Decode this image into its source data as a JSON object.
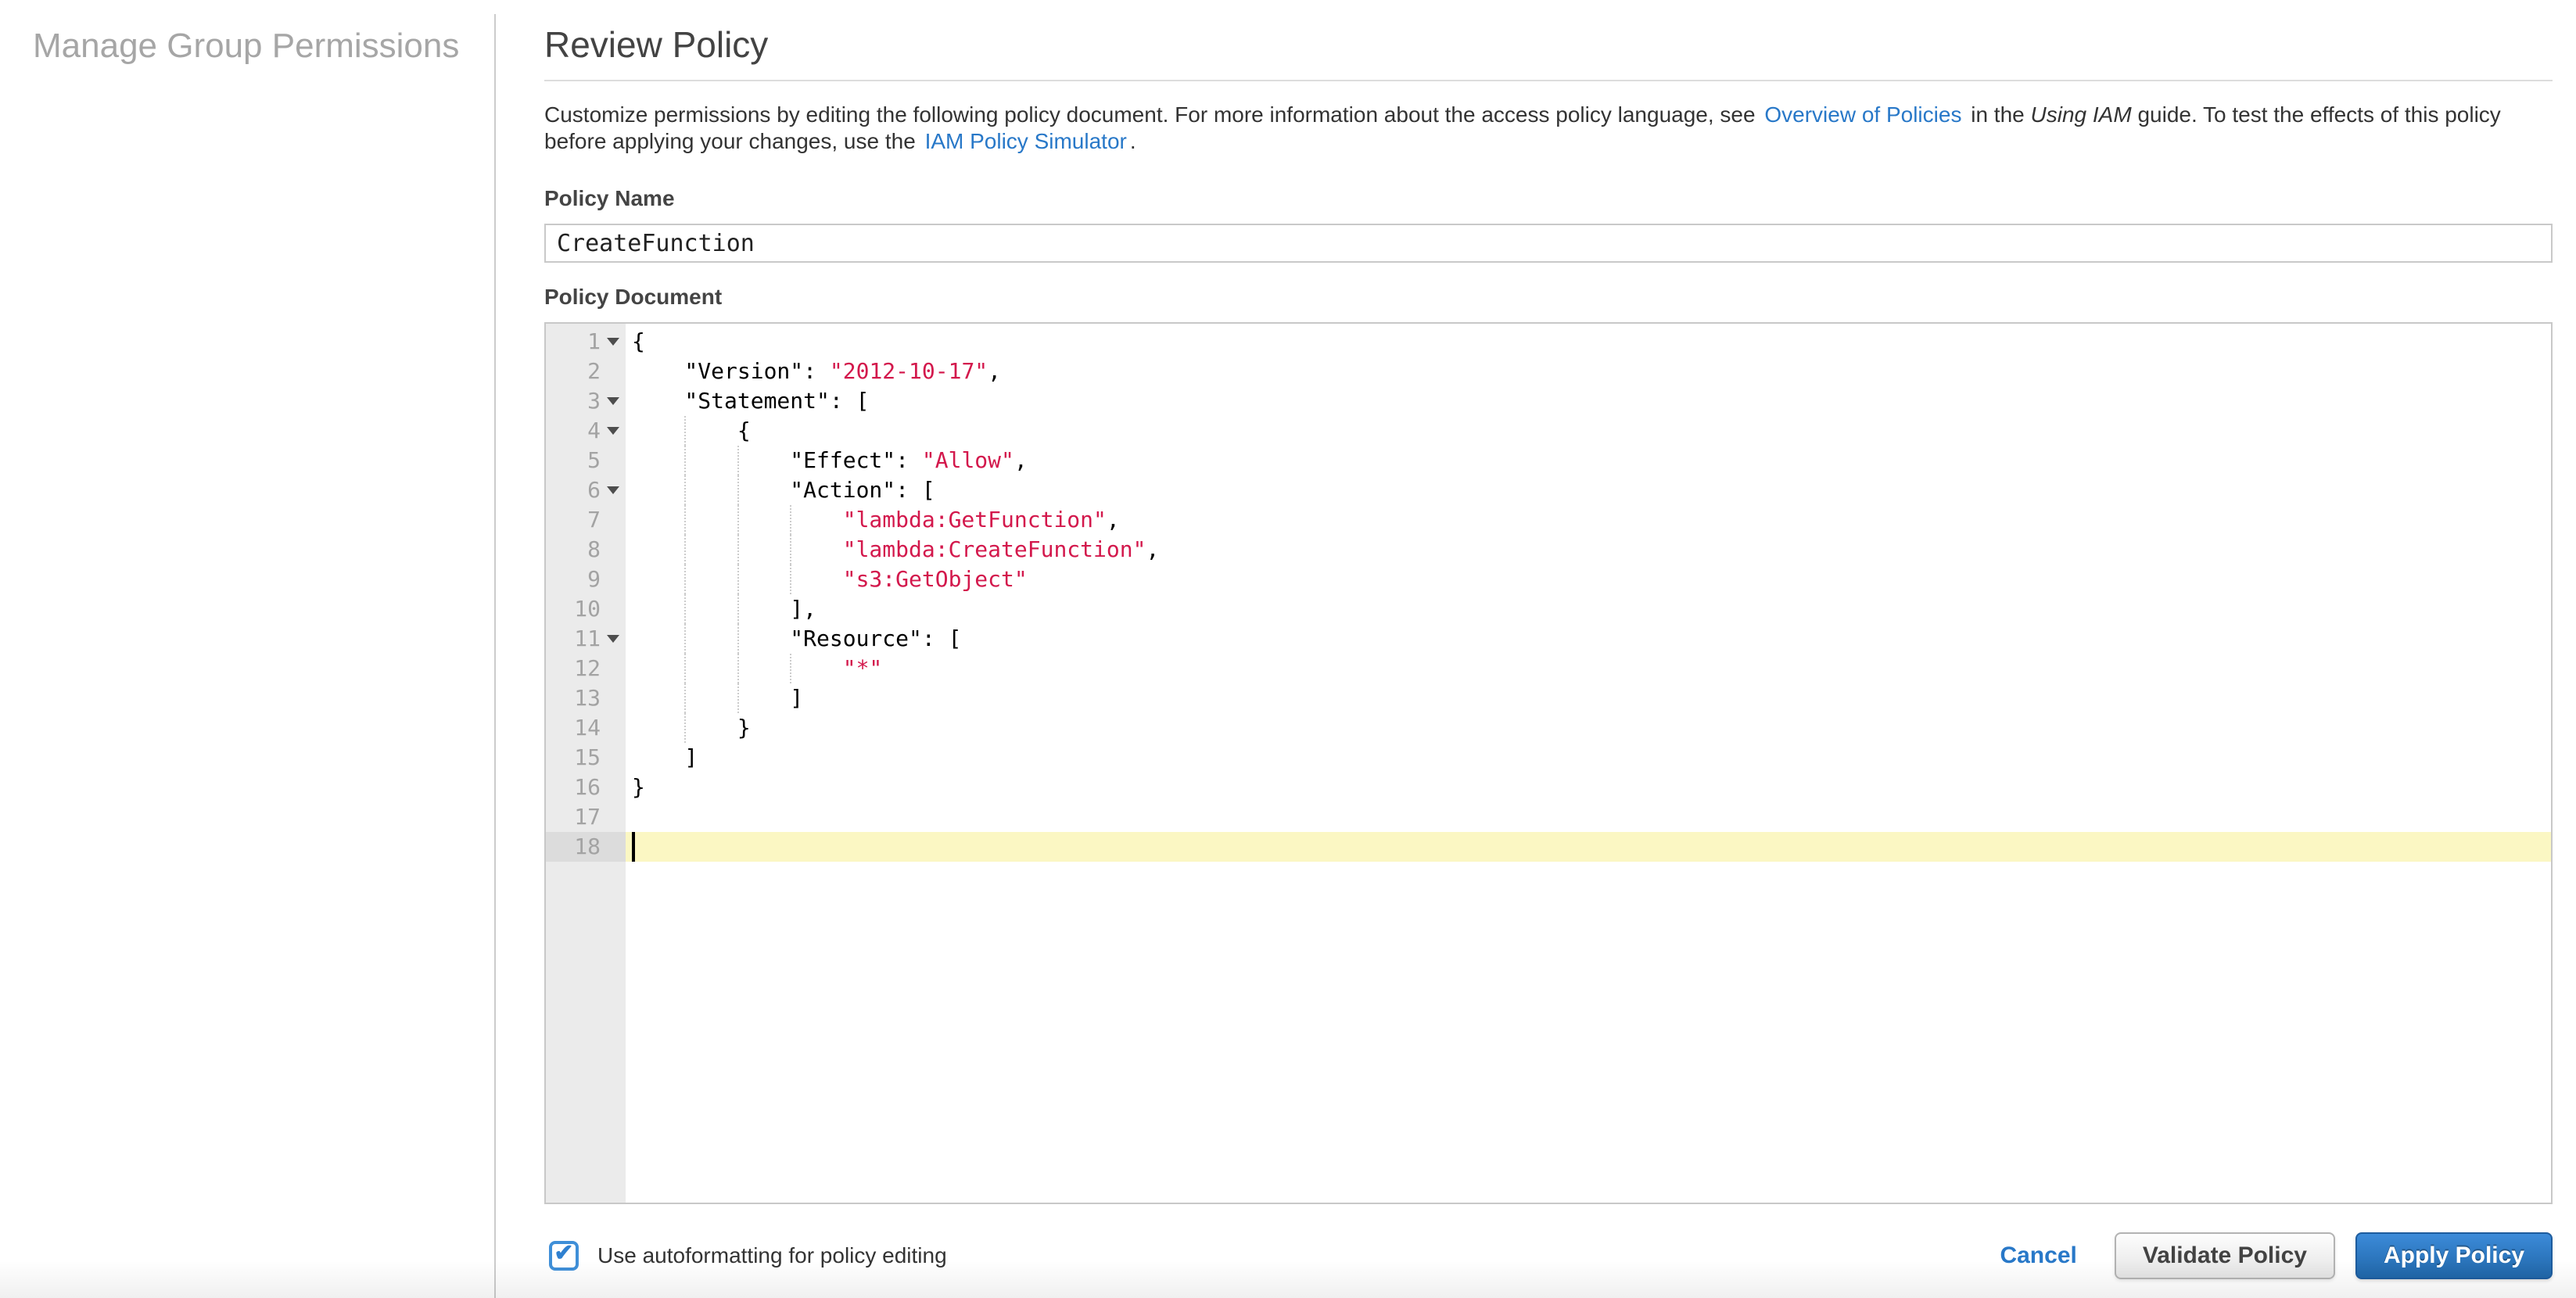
{
  "sidebar": {
    "title": "Manage Group Permissions"
  },
  "header": {
    "title": "Review Policy"
  },
  "description": {
    "parts": [
      {
        "t": "Customize permissions by editing the following policy document. For more information about the access policy language, see"
      },
      {
        "t": "Overview of Policies",
        "link": true
      },
      {
        "t": "in the"
      },
      {
        "t": "Using IAM",
        "italic": true
      },
      {
        "t": "guide. To test the effects of this policy"
      },
      {
        "br": true
      },
      {
        "t": "before applying your changes, use the"
      },
      {
        "t": "IAM Policy Simulator",
        "link": true
      },
      {
        "t": "."
      }
    ]
  },
  "policy_name": {
    "label": "Policy Name",
    "value": "CreateFunction"
  },
  "policy_document": {
    "label": "Policy Document"
  },
  "editor": {
    "active_line": 18,
    "lines": [
      {
        "n": 1,
        "fold": true,
        "segs": [
          {
            "t": "{"
          }
        ]
      },
      {
        "n": 2,
        "segs": [
          {
            "t": "    \"Version\": "
          },
          {
            "t": "\"2012-10-17\"",
            "s": 1
          },
          {
            "t": ","
          }
        ]
      },
      {
        "n": 3,
        "fold": true,
        "segs": [
          {
            "t": "    \"Statement\": ["
          }
        ]
      },
      {
        "n": 4,
        "fold": true,
        "segs": [
          {
            "t": "        {"
          }
        ]
      },
      {
        "n": 5,
        "segs": [
          {
            "t": "            \"Effect\": "
          },
          {
            "t": "\"Allow\"",
            "s": 1
          },
          {
            "t": ","
          }
        ]
      },
      {
        "n": 6,
        "fold": true,
        "segs": [
          {
            "t": "            \"Action\": ["
          }
        ]
      },
      {
        "n": 7,
        "segs": [
          {
            "t": "                "
          },
          {
            "t": "\"lambda:GetFunction\"",
            "s": 1
          },
          {
            "t": ","
          }
        ]
      },
      {
        "n": 8,
        "segs": [
          {
            "t": "                "
          },
          {
            "t": "\"lambda:CreateFunction\"",
            "s": 1
          },
          {
            "t": ","
          }
        ]
      },
      {
        "n": 9,
        "segs": [
          {
            "t": "                "
          },
          {
            "t": "\"s3:GetObject\"",
            "s": 1
          }
        ]
      },
      {
        "n": 10,
        "segs": [
          {
            "t": "            ],"
          }
        ]
      },
      {
        "n": 11,
        "fold": true,
        "segs": [
          {
            "t": "            \"Resource\": ["
          }
        ]
      },
      {
        "n": 12,
        "segs": [
          {
            "t": "                "
          },
          {
            "t": "\"*\"",
            "s": 1
          }
        ]
      },
      {
        "n": 13,
        "segs": [
          {
            "t": "            ]"
          }
        ]
      },
      {
        "n": 14,
        "segs": [
          {
            "t": "        }"
          }
        ]
      },
      {
        "n": 15,
        "segs": [
          {
            "t": "    ]"
          }
        ]
      },
      {
        "n": 16,
        "segs": [
          {
            "t": "}"
          }
        ]
      },
      {
        "n": 17,
        "segs": []
      },
      {
        "n": 18,
        "active": true,
        "cursor": true,
        "segs": []
      }
    ]
  },
  "footer": {
    "autoformat_label": "Use autoformatting for policy editing",
    "autoformat_checked": true,
    "cancel_label": "Cancel",
    "validate_label": "Validate Policy",
    "apply_label": "Apply Policy"
  },
  "colors": {
    "link": "#2878c8",
    "code-string": "#d3184c",
    "active-line": "#fbf7c3",
    "apply-top": "#3c8bd9",
    "apply-bottom": "#2066a8",
    "apply-border": "#1d5c9e",
    "checkbox": "#3f8fd8"
  }
}
